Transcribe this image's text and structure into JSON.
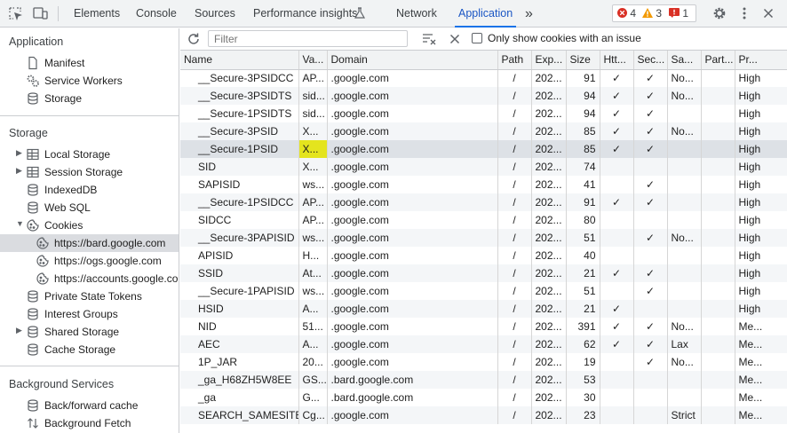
{
  "tabs": [
    {
      "label": "Elements"
    },
    {
      "label": "Console"
    },
    {
      "label": "Sources"
    },
    {
      "label": "Performance insights"
    },
    {
      "label": "Network"
    },
    {
      "label": "Application"
    }
  ],
  "active_tab": "Application",
  "more_tabs": "»",
  "issues": {
    "errors": "4",
    "warnings": "3",
    "messages": "1"
  },
  "sidebar": {
    "application_title": "Application",
    "application_items": [
      "Manifest",
      "Service Workers",
      "Storage"
    ],
    "storage_title": "Storage",
    "storage_items": [
      "Local Storage",
      "Session Storage",
      "IndexedDB",
      "Web SQL",
      "Cookies"
    ],
    "cookie_origins": [
      "https://bard.google.com",
      "https://ogs.google.com",
      "https://accounts.google.co"
    ],
    "storage_items_2": [
      "Private State Tokens",
      "Interest Groups",
      "Shared Storage",
      "Cache Storage"
    ],
    "background_title": "Background Services",
    "background_items": [
      "Back/forward cache",
      "Background Fetch"
    ]
  },
  "toolbar": {
    "filter_placeholder": "Filter",
    "only_issues_label": "Only show cookies with an issue"
  },
  "table": {
    "columns": [
      "Name",
      "Va...",
      "Domain",
      "Path",
      "Exp...",
      "Size",
      "Htt...",
      "Sec...",
      "Sa...",
      "Part...",
      "Pr..."
    ],
    "rows": [
      [
        "__Secure-3PSIDCC",
        "AP...",
        ".google.com",
        "/",
        "202...",
        "91",
        "✓",
        "✓",
        "No...",
        "",
        "High"
      ],
      [
        "__Secure-3PSIDTS",
        "sid...",
        ".google.com",
        "/",
        "202...",
        "94",
        "✓",
        "✓",
        "No...",
        "",
        "High"
      ],
      [
        "__Secure-1PSIDTS",
        "sid...",
        ".google.com",
        "/",
        "202...",
        "94",
        "✓",
        "✓",
        "",
        "",
        "High"
      ],
      [
        "__Secure-3PSID",
        "X...",
        ".google.com",
        "/",
        "202...",
        "85",
        "✓",
        "✓",
        "No...",
        "",
        "High"
      ],
      [
        "__Secure-1PSID",
        "X...",
        ".google.com",
        "/",
        "202...",
        "85",
        "✓",
        "✓",
        "",
        "",
        "High"
      ],
      [
        "SID",
        "X...",
        ".google.com",
        "/",
        "202...",
        "74",
        "",
        "",
        "",
        "",
        "High"
      ],
      [
        "SAPISID",
        "ws...",
        ".google.com",
        "/",
        "202...",
        "41",
        "",
        "✓",
        "",
        "",
        "High"
      ],
      [
        "__Secure-1PSIDCC",
        "AP...",
        ".google.com",
        "/",
        "202...",
        "91",
        "✓",
        "✓",
        "",
        "",
        "High"
      ],
      [
        "SIDCC",
        "AP...",
        ".google.com",
        "/",
        "202...",
        "80",
        "",
        "",
        "",
        "",
        "High"
      ],
      [
        "__Secure-3PAPISID",
        "ws...",
        ".google.com",
        "/",
        "202...",
        "51",
        "",
        "✓",
        "No...",
        "",
        "High"
      ],
      [
        "APISID",
        "H...",
        ".google.com",
        "/",
        "202...",
        "40",
        "",
        "",
        "",
        "",
        "High"
      ],
      [
        "SSID",
        "At...",
        ".google.com",
        "/",
        "202...",
        "21",
        "✓",
        "✓",
        "",
        "",
        "High"
      ],
      [
        "__Secure-1PAPISID",
        "ws...",
        ".google.com",
        "/",
        "202...",
        "51",
        "",
        "✓",
        "",
        "",
        "High"
      ],
      [
        "HSID",
        "A...",
        ".google.com",
        "/",
        "202...",
        "21",
        "✓",
        "",
        "",
        "",
        "High"
      ],
      [
        "NID",
        "51...",
        ".google.com",
        "/",
        "202...",
        "391",
        "✓",
        "✓",
        "No...",
        "",
        "Me..."
      ],
      [
        "AEC",
        "A...",
        ".google.com",
        "/",
        "202...",
        "62",
        "✓",
        "✓",
        "Lax",
        "",
        "Me..."
      ],
      [
        "1P_JAR",
        "20...",
        ".google.com",
        "/",
        "202...",
        "19",
        "",
        "✓",
        "No...",
        "",
        "Me..."
      ],
      [
        "_ga_H68ZH5W8EE",
        "GS...",
        ".bard.google.com",
        "/",
        "202...",
        "53",
        "",
        "",
        "",
        "",
        "Me..."
      ],
      [
        "_ga",
        "G...",
        ".bard.google.com",
        "/",
        "202...",
        "30",
        "",
        "",
        "",
        "",
        "Me..."
      ],
      [
        "SEARCH_SAMESITE",
        "Cg...",
        ".google.com",
        "/",
        "202...",
        "23",
        "",
        "",
        "Strict",
        "",
        "Me..."
      ]
    ]
  },
  "colors": {
    "accent": "#1a73e8",
    "highlight": "#e4e41e",
    "error": "#d93025",
    "warning": "#f29900"
  }
}
